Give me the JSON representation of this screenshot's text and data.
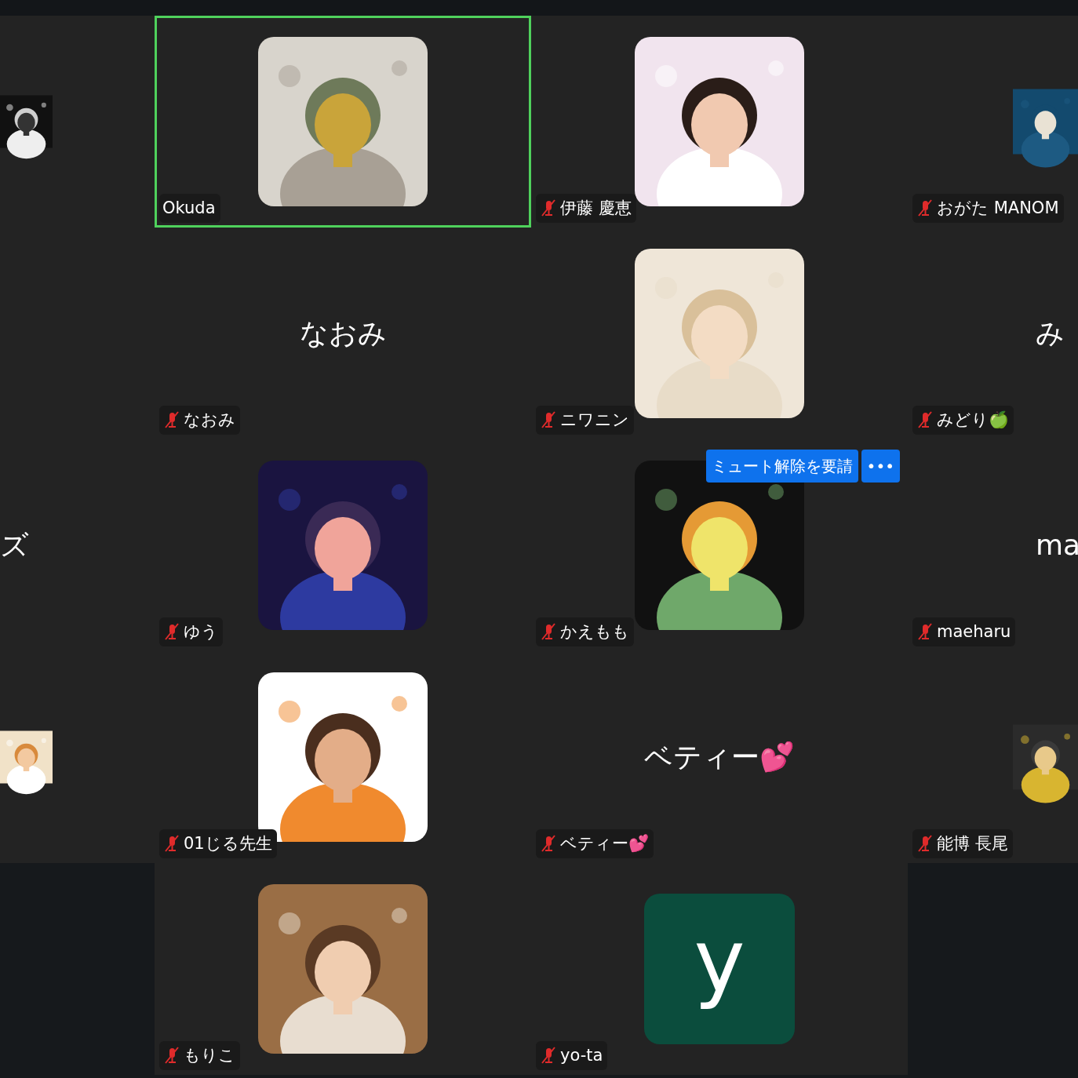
{
  "rows": [
    {
      "tiles": [
        {
          "kind": "picture",
          "selected": false
        },
        {
          "kind": "picture",
          "name": "Okuda",
          "muted": false,
          "selected": true
        },
        {
          "kind": "picture",
          "name": "伊藤 慶恵",
          "muted": true,
          "selected": false
        },
        {
          "kind": "picture",
          "name": "おがた MANOM",
          "muted": true,
          "selected": false
        }
      ]
    },
    {
      "tiles": [
        {
          "kind": "blank",
          "selected": false
        },
        {
          "kind": "name",
          "display_name": "なおみ",
          "name": "なおみ",
          "muted": true,
          "selected": false
        },
        {
          "kind": "picture",
          "name": "ニワニン",
          "muted": true,
          "selected": false
        },
        {
          "kind": "name",
          "display_name": "み",
          "name": "みどり🍏",
          "muted": true,
          "selected": false
        }
      ]
    },
    {
      "tiles": [
        {
          "kind": "name",
          "display_name": "ズ",
          "selected": false
        },
        {
          "kind": "picture",
          "name": "ゆう",
          "muted": true,
          "selected": false
        },
        {
          "kind": "picture",
          "name": "かえもも",
          "muted": true,
          "selected": false,
          "hover_actions": [
            "ミュート解除を要請",
            "•••"
          ]
        },
        {
          "kind": "name",
          "display_name": "ma",
          "name": "maeharu",
          "muted": true,
          "selected": false
        }
      ]
    },
    {
      "tiles": [
        {
          "kind": "picture",
          "selected": false
        },
        {
          "kind": "picture",
          "name": "01じる先生",
          "muted": true,
          "selected": false
        },
        {
          "kind": "name",
          "display_name": "ベティー💕",
          "name": "ベティー💕",
          "muted": true,
          "selected": false
        },
        {
          "kind": "picture",
          "name": "能博 長尾",
          "muted": true,
          "selected": false
        }
      ]
    },
    {
      "tiles": [
        {
          "kind": "picture",
          "name": "もりこ",
          "muted": true,
          "selected": false
        },
        {
          "kind": "initial",
          "display_name": "y",
          "name": "yo-ta",
          "muted": true,
          "selected": false
        }
      ]
    }
  ]
}
